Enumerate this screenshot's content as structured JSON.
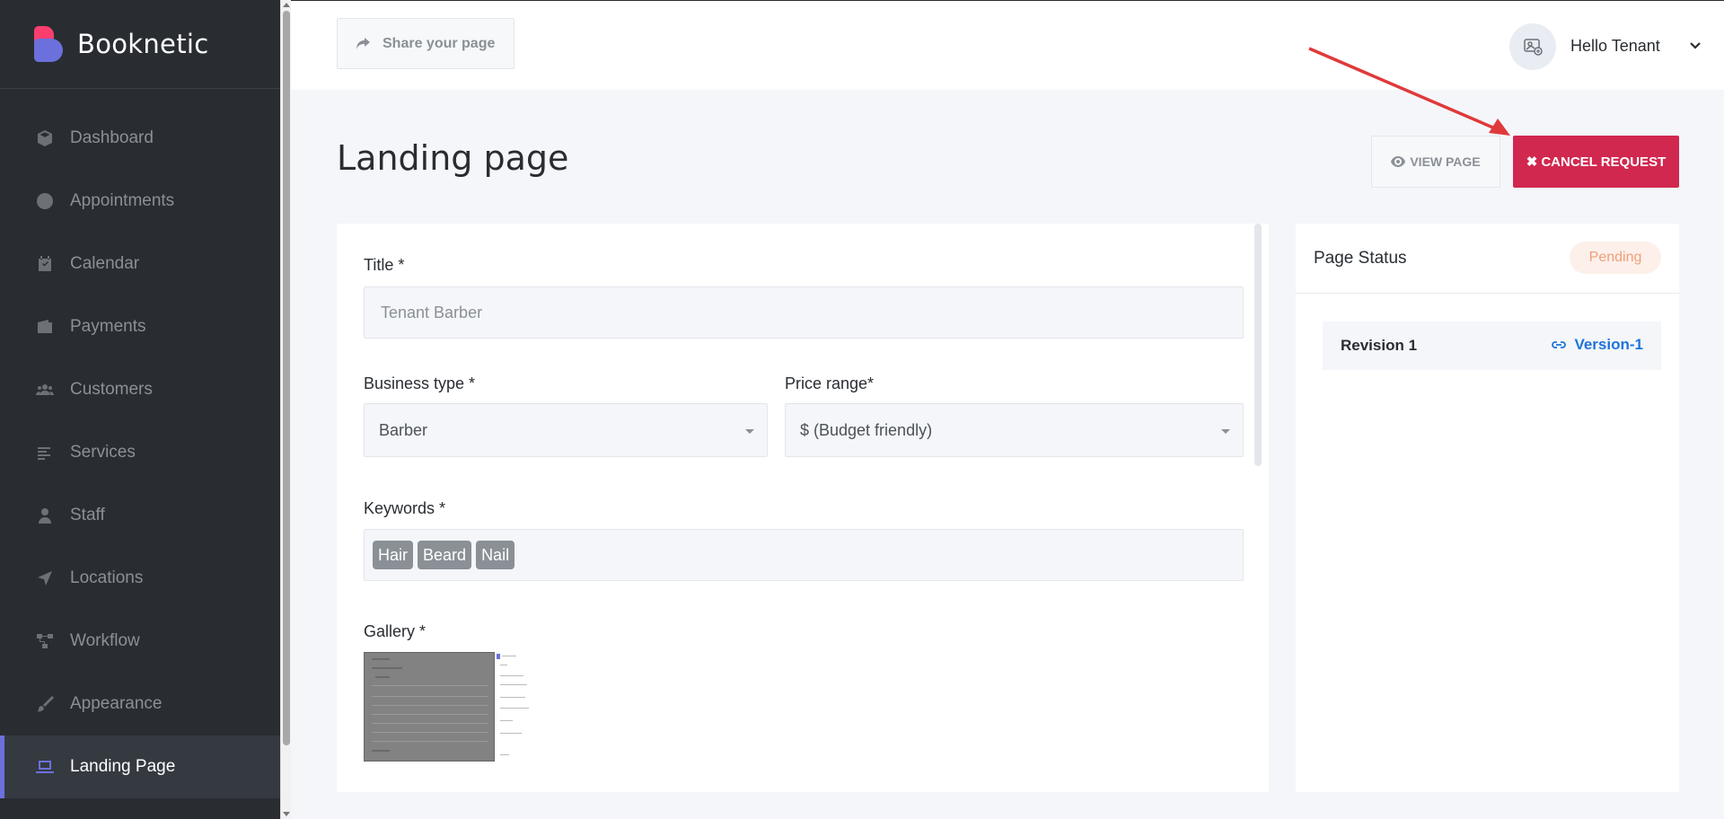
{
  "brand": {
    "name": "Booknetic"
  },
  "sidebar": {
    "items": [
      {
        "label": "Dashboard",
        "icon": "cube-icon"
      },
      {
        "label": "Appointments",
        "icon": "clock-icon"
      },
      {
        "label": "Calendar",
        "icon": "calendar-icon"
      },
      {
        "label": "Payments",
        "icon": "wallet-icon"
      },
      {
        "label": "Customers",
        "icon": "users-icon"
      },
      {
        "label": "Services",
        "icon": "list-icon"
      },
      {
        "label": "Staff",
        "icon": "user-icon"
      },
      {
        "label": "Locations",
        "icon": "location-arrow-icon"
      },
      {
        "label": "Workflow",
        "icon": "workflow-icon"
      },
      {
        "label": "Appearance",
        "icon": "brush-icon"
      },
      {
        "label": "Landing Page",
        "icon": "laptop-icon",
        "active": true
      }
    ]
  },
  "topbar": {
    "share_label": "Share your page",
    "user_greeting": "Hello Tenant"
  },
  "page": {
    "title": "Landing page",
    "view_label": "VIEW PAGE",
    "cancel_label": "CANCEL REQUEST"
  },
  "form": {
    "title_label": "Title *",
    "title_value": "Tenant Barber",
    "business_type_label": "Business type *",
    "business_type_value": "Barber",
    "price_range_label": "Price range*",
    "price_range_value": "$ (Budget friendly)",
    "keywords_label": "Keywords *",
    "keywords": [
      "Hair",
      "Beard",
      "Nail"
    ],
    "gallery_label": "Gallery *"
  },
  "status": {
    "title": "Page Status",
    "badge": "Pending",
    "revision_label": "Revision 1",
    "revision_link": "Version-1"
  },
  "colors": {
    "sidebar_bg": "#292d32",
    "accent": "#6c70dc",
    "cancel": "#d1284f",
    "pending": "#f09f7a",
    "link": "#1e74d9"
  }
}
